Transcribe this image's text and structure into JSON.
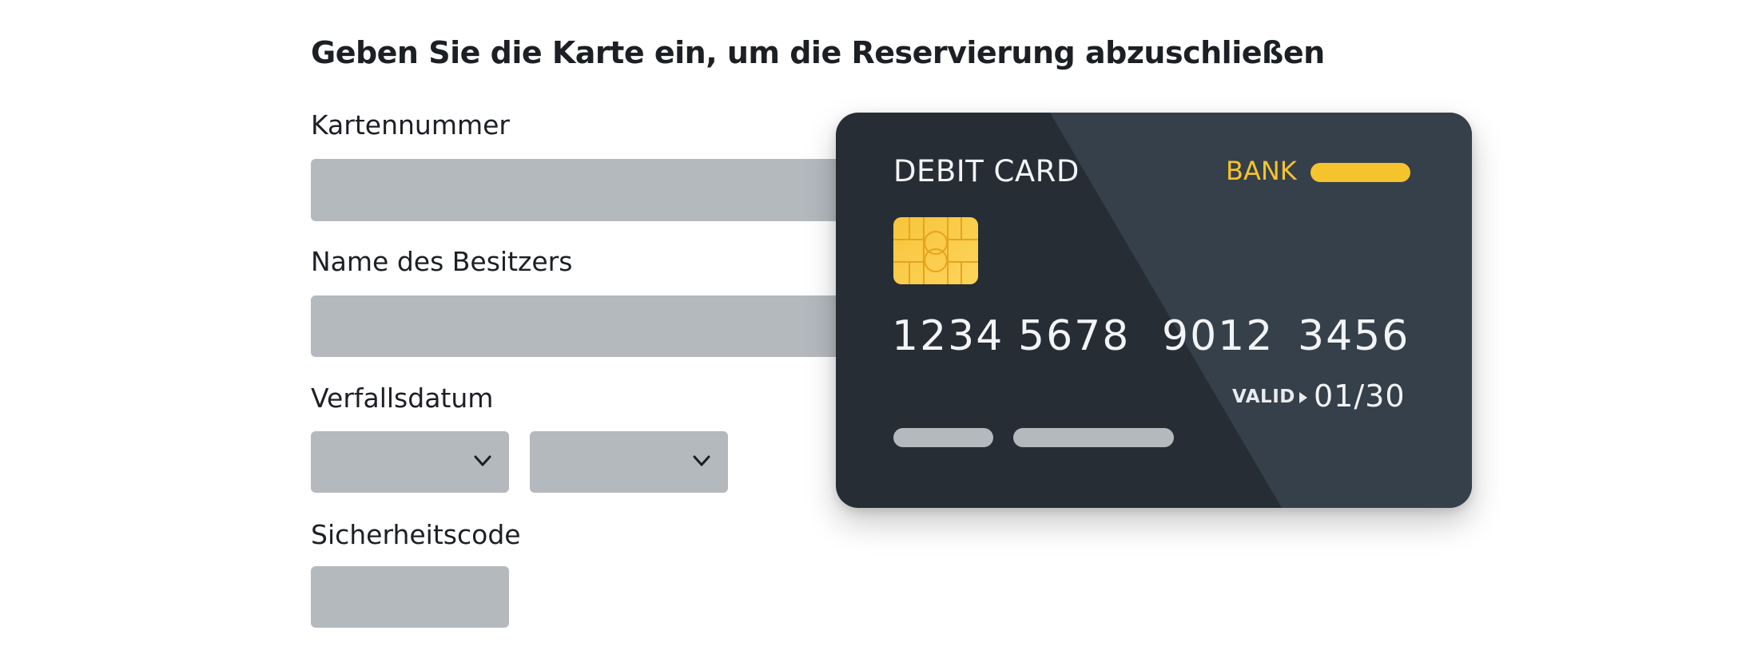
{
  "form": {
    "title": "Geben Sie die Karte ein, um die Reservierung abzuschließen",
    "card_number_label": "Kartennummer",
    "card_number_value": "",
    "owner_name_label": "Name des Besitzers",
    "owner_name_value": "",
    "expiry_label": "Verfallsdatum",
    "expiry_month_value": "",
    "expiry_year_value": "",
    "security_code_label": "Sicherheitscode",
    "security_code_value": ""
  },
  "card": {
    "type_label": "DEBIT CARD",
    "bank_label": "BANK",
    "number_groups": [
      "1234",
      "5678",
      "9012",
      "3456"
    ],
    "valid_label": "VALID",
    "valid_date": "01/30",
    "icons": [
      "chip-icon",
      "arrow-right-icon",
      "chevron-down-icon"
    ]
  },
  "colors": {
    "card_background": "#262d35",
    "card_sheen": "#36404a",
    "accent_yellow": "#f5c32c",
    "input_background": "#b4b9be",
    "text": "#1c1f24"
  }
}
